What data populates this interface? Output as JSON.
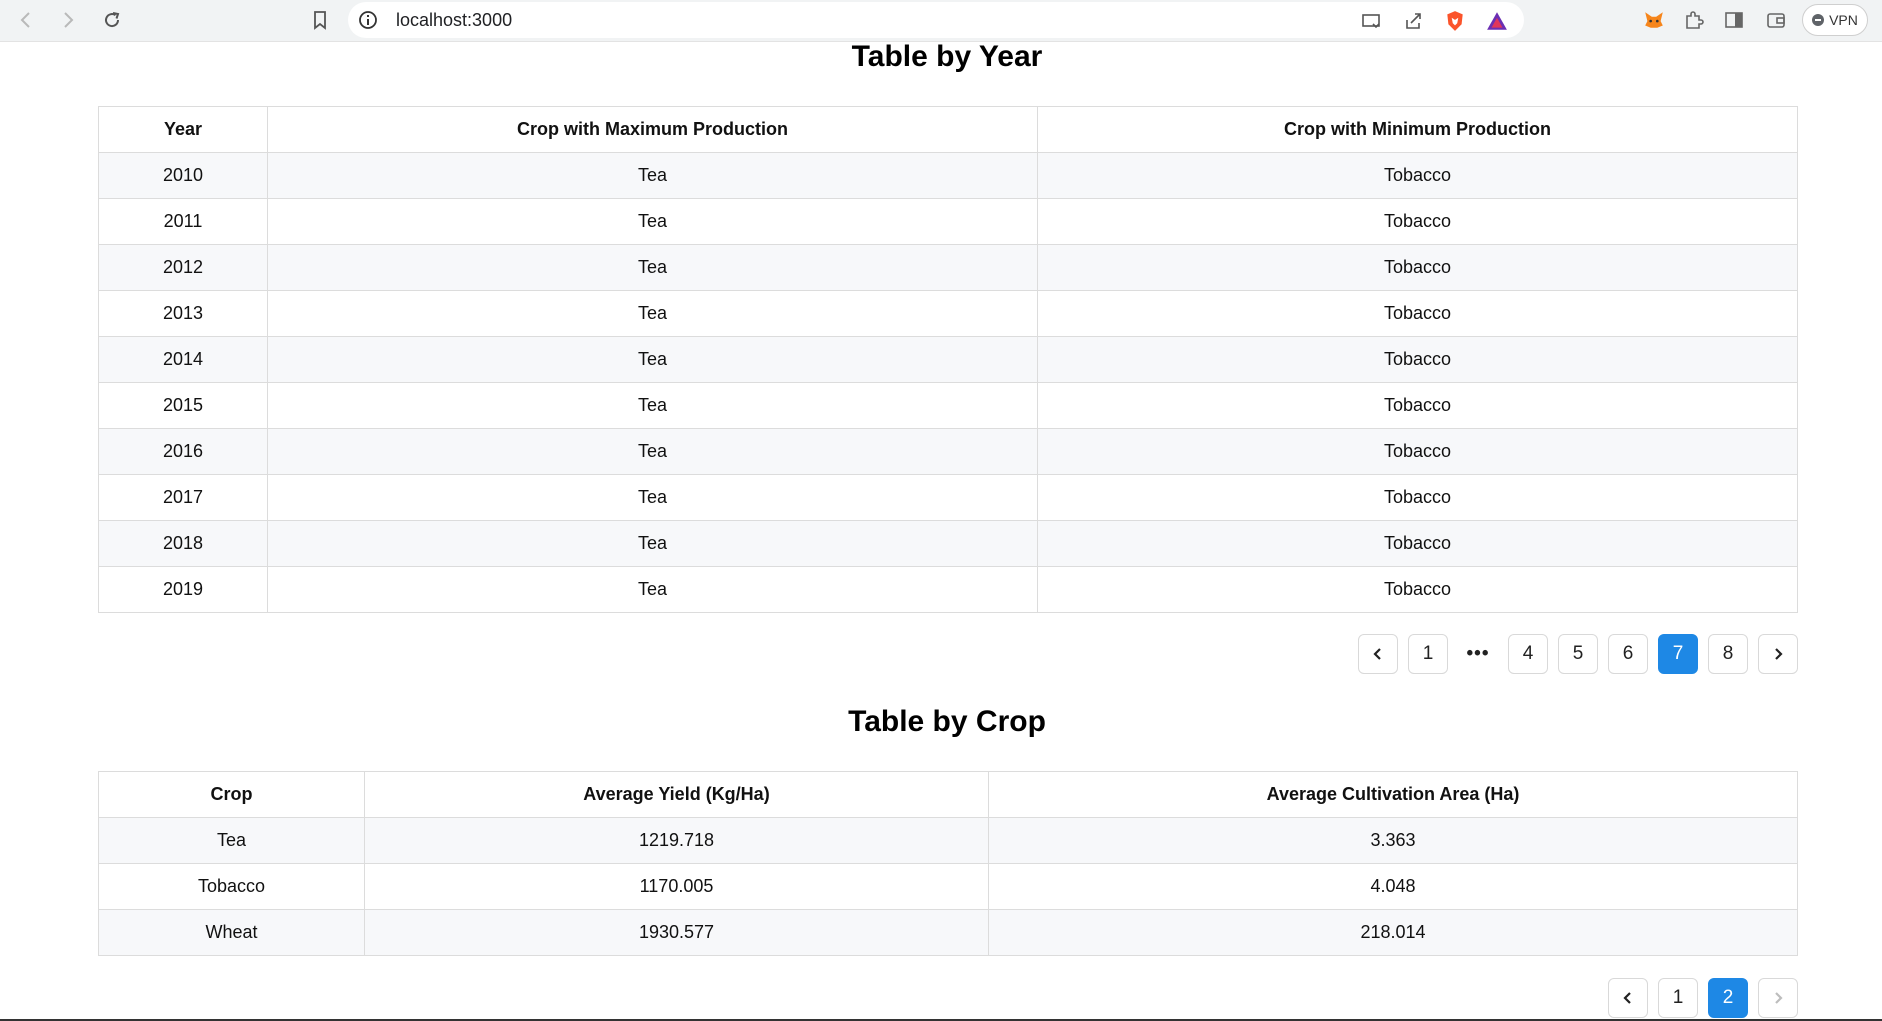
{
  "browser": {
    "url": "localhost:3000",
    "vpn_label": "VPN"
  },
  "year_table": {
    "title": "Table by Year",
    "headers": [
      "Year",
      "Crop with Maximum Production",
      "Crop with Minimum Production"
    ],
    "rows": [
      [
        "2010",
        "Tea",
        "Tobacco"
      ],
      [
        "2011",
        "Tea",
        "Tobacco"
      ],
      [
        "2012",
        "Tea",
        "Tobacco"
      ],
      [
        "2013",
        "Tea",
        "Tobacco"
      ],
      [
        "2014",
        "Tea",
        "Tobacco"
      ],
      [
        "2015",
        "Tea",
        "Tobacco"
      ],
      [
        "2016",
        "Tea",
        "Tobacco"
      ],
      [
        "2017",
        "Tea",
        "Tobacco"
      ],
      [
        "2018",
        "Tea",
        "Tobacco"
      ],
      [
        "2019",
        "Tea",
        "Tobacco"
      ]
    ],
    "pagination": {
      "pages": [
        "1",
        "•••",
        "4",
        "5",
        "6",
        "7",
        "8"
      ],
      "current": "7"
    }
  },
  "crop_table": {
    "title": "Table by Crop",
    "headers": [
      "Crop",
      "Average Yield (Kg/Ha)",
      "Average Cultivation Area (Ha)"
    ],
    "rows": [
      [
        "Tea",
        "1219.718",
        "3.363"
      ],
      [
        "Tobacco",
        "1170.005",
        "4.048"
      ],
      [
        "Wheat",
        "1930.577",
        "218.014"
      ]
    ],
    "pagination": {
      "pages": [
        "1",
        "2"
      ],
      "current": "2"
    }
  },
  "colors": {
    "accent": "#1e88e5",
    "row_stripe": "#f7f8fa",
    "border": "#dcdcdc"
  }
}
